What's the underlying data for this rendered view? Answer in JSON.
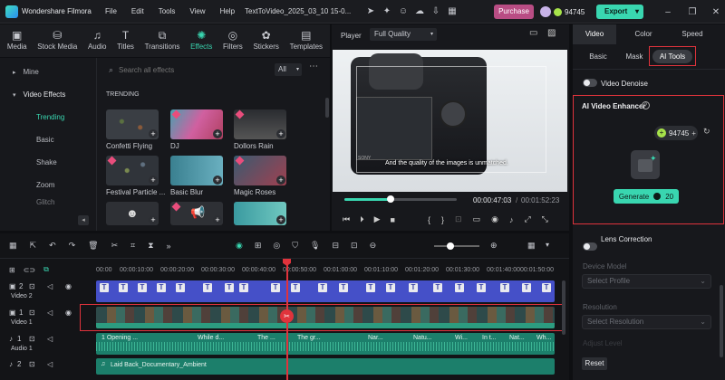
{
  "app": {
    "name": "Wondershare Filmora",
    "menus": [
      "File",
      "Edit",
      "Tools",
      "View",
      "Help"
    ],
    "project_title": "TextToVideo_2025_03_10 15-0...",
    "purchase": "Purchase",
    "credits": "94745",
    "export": "Export"
  },
  "media_tabs": [
    {
      "label": "Media",
      "icon": "media-icon"
    },
    {
      "label": "Stock Media",
      "icon": "stock-media-icon"
    },
    {
      "label": "Audio",
      "icon": "audio-icon"
    },
    {
      "label": "Titles",
      "icon": "titles-icon"
    },
    {
      "label": "Transitions",
      "icon": "transitions-icon"
    },
    {
      "label": "Effects",
      "icon": "effects-icon",
      "active": true
    },
    {
      "label": "Filters",
      "icon": "filters-icon"
    },
    {
      "label": "Stickers",
      "icon": "stickers-icon"
    },
    {
      "label": "Templates",
      "icon": "templates-icon"
    }
  ],
  "effects": {
    "nav": {
      "mine": "Mine",
      "video_effects": "Video Effects",
      "items": [
        "Trending",
        "Basic",
        "Shake",
        "Zoom",
        "Glitch"
      ]
    },
    "search_placeholder": "Search all effects",
    "filter": "All",
    "section": "TRENDING",
    "items": [
      "Confetti Flying",
      "DJ",
      "Dollors Rain",
      "Festival Particle ...",
      "Basic Blur",
      "Magic Roses",
      "",
      "",
      ""
    ]
  },
  "player": {
    "label": "Player",
    "quality": "Full Quality",
    "subtitle": "And the quality of the images is unmatched.",
    "current_time": "00:00:47:03",
    "total_time": "00:01:52:23",
    "camera_brand": "SONY"
  },
  "right_panel": {
    "tabs": [
      "Video",
      "Color",
      "Speed"
    ],
    "subtabs": [
      "Basic",
      "Mask",
      "AI Tools"
    ],
    "video_denoise": "Video Denoise",
    "enhancer_title": "AI Video Enhancer",
    "credits": "94745",
    "generate": "Generate",
    "generate_cost": "20",
    "lens_correction": "Lens Correction",
    "device_model_label": "Device Model",
    "device_model_placeholder": "Select Profile",
    "resolution_label": "Resolution",
    "resolution_placeholder": "Select Resolution",
    "adjust_label": "Adjust Level",
    "reset": "Reset",
    "colors": {
      "accent": "#39d6b0",
      "highlight": "#e0333c"
    }
  },
  "timeline": {
    "ruler": [
      "00:00",
      "00:00:10:00",
      "00:00:20:00",
      "00:00:30:00",
      "00:00:40:00",
      "00:00:50:00",
      "00:01:00:00",
      "00:01:10:00",
      "00:01:20:00",
      "00:01:30:00",
      "00:01:40:00",
      "00:01:50:00"
    ],
    "tracks": [
      {
        "num": "2",
        "label": "Video 2"
      },
      {
        "num": "1",
        "label": "Video 1"
      },
      {
        "num": "1",
        "label": "Audio 1"
      },
      {
        "num": "2",
        "label": "Audio 2"
      }
    ],
    "audio_clips": [
      "1 Opening ...",
      "While d...",
      "The ...",
      "The gr...",
      "Nar...",
      "Natu...",
      "Wi...",
      "In t...",
      "Nat...",
      "Wh..."
    ],
    "music": "Laid Back_Documentary_Ambient"
  }
}
